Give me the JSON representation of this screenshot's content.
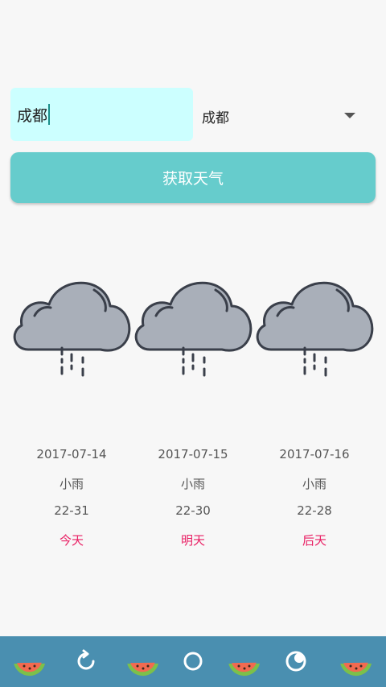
{
  "form": {
    "city_input_value": "成都",
    "city_select_value": "成都",
    "get_weather_label": "获取天气"
  },
  "days": [
    {
      "date": "2017-07-14",
      "weather": "小雨",
      "temp": "22-31",
      "label": "今天",
      "icon": "light-rain-cloud-icon"
    },
    {
      "date": "2017-07-15",
      "weather": "小雨",
      "temp": "22-30",
      "label": "明天",
      "icon": "light-rain-cloud-icon"
    },
    {
      "date": "2017-07-16",
      "weather": "小雨",
      "temp": "22-28",
      "label": "后天",
      "icon": "light-rain-cloud-icon"
    }
  ],
  "bottom_bar": {
    "items": [
      "watermelon-icon",
      "refresh-icon",
      "watermelon-icon",
      "circle-icon",
      "watermelon-icon",
      "moon-icon",
      "watermelon-icon"
    ]
  },
  "colors": {
    "input_bg": "#ccffff",
    "button_bg": "#66cccc",
    "label_accent": "#e91e63",
    "bottom_bar_bg": "#4a8fb0",
    "cloud_fill": "#a9afb9"
  }
}
